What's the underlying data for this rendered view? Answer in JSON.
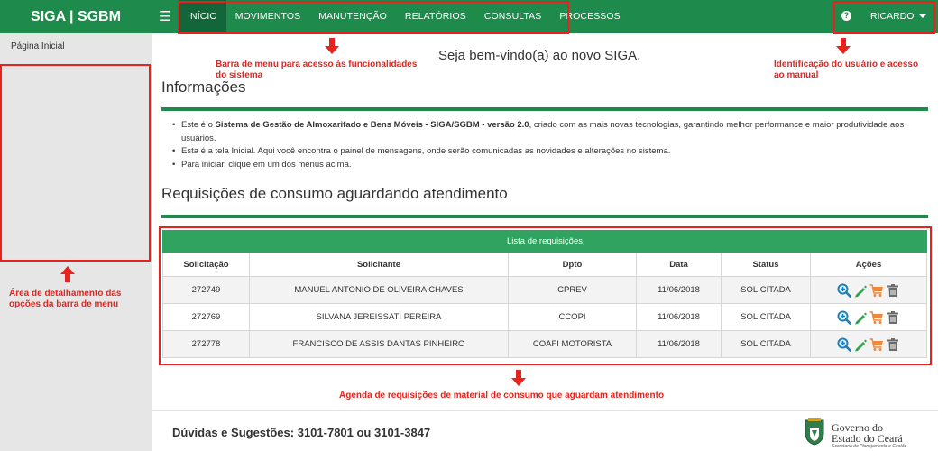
{
  "app": {
    "brand": "SIGA | SGBM"
  },
  "menu": {
    "items": [
      {
        "label": "INÍCIO"
      },
      {
        "label": "MOVIMENTOS"
      },
      {
        "label": "MANUTENÇÃO"
      },
      {
        "label": "RELATÓRIOS"
      },
      {
        "label": "CONSULTAS"
      },
      {
        "label": "PROCESSOS"
      }
    ],
    "active": "INÍCIO"
  },
  "user": {
    "help_glyph": "?",
    "name": "RICARDO"
  },
  "sidebar": {
    "items": [
      {
        "label": "Página Inicial"
      }
    ]
  },
  "annotations": {
    "menu_bar_line1": "Barra de menu para acesso às funcionalidades",
    "menu_bar_line2": "do sistema",
    "user_line1": "Identificação do usuário e acesso",
    "user_line2": "ao manual",
    "sidebar_line1": "Área de detalhamento das",
    "sidebar_line2": "opções da barra de menu",
    "table_note": "Agenda de requisições de material de consumo que aguardam atendimento"
  },
  "main": {
    "welcome": "Seja bem-vindo(a) ao novo SIGA.",
    "info_heading": "Informações",
    "info_bullets": [
      {
        "prefix": "Este é o ",
        "bold": "Sistema de Gestão de Almoxarifado e Bens Móveis - SIGA/SGBM - versão 2.0",
        "suffix": ", criado com as mais novas tecnologias, garantindo melhor performance e maior produtividade aos usuários."
      },
      {
        "text": "Esta é a tela Inicial. Aqui você encontra o painel de mensagens, onde serão comunicadas as novidades e alterações no sistema."
      },
      {
        "text": "Para iniciar, clique em um dos menus acima."
      }
    ],
    "requests_heading": "Requisições de consumo aguardando atendimento"
  },
  "table": {
    "title": "Lista de requisições",
    "columns": [
      "Solicitação",
      "Solicitante",
      "Dpto",
      "Data",
      "Status",
      "Ações"
    ],
    "rows": [
      {
        "id": "272749",
        "requester": "MANUEL ANTONIO DE OLIVEIRA CHAVES",
        "dept": "CPREV",
        "date": "11/06/2018",
        "status": "SOLICITADA"
      },
      {
        "id": "272769",
        "requester": "SILVANA JEREISSATI PEREIRA",
        "dept": "CCOPI",
        "date": "11/06/2018",
        "status": "SOLICITADA"
      },
      {
        "id": "272778",
        "requester": "FRANCISCO DE ASSIS DANTAS PINHEIRO",
        "dept": "COAFI MOTORISTA",
        "date": "11/06/2018",
        "status": "SOLICITADA"
      }
    ],
    "action_icons": [
      "zoom-in-icon",
      "pencil-icon",
      "cart-icon",
      "trash-icon"
    ]
  },
  "footer": {
    "contact": "Dúvidas e Sugestões: 3101-7801 ou 3101-3847",
    "gov_line1": "Governo do",
    "gov_line2": "Estado do Ceará",
    "gov_sub": "Secretaria do Planejamento e Gestão"
  },
  "colors": {
    "primary_green": "#1e8a4c",
    "active_green": "#13663a",
    "table_header_green": "#2fa35f",
    "annotation_red": "#e8231d",
    "action_blue": "#1a7fb8",
    "action_green": "#33a34a",
    "action_orange": "#f0883c",
    "action_gray": "#6b6b6b"
  }
}
